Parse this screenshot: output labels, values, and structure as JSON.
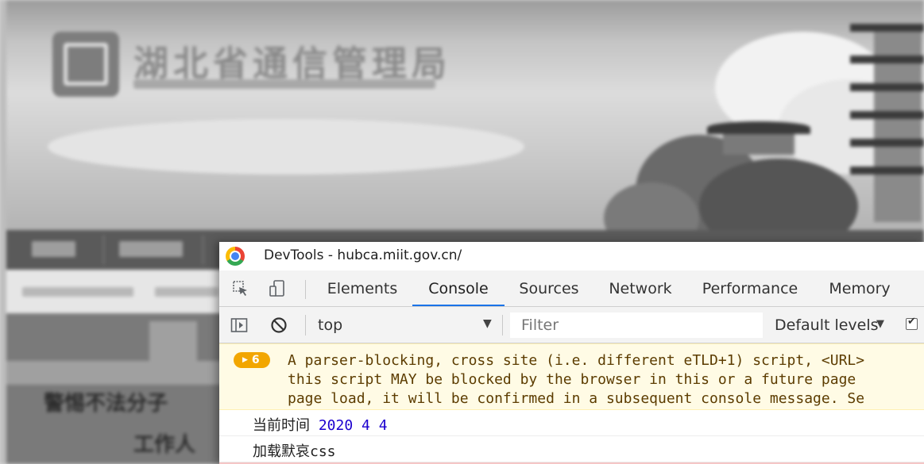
{
  "site": {
    "logo_title": "湖北省通信管理局",
    "headline_line1": "警惕不法分子",
    "headline_line2": "工作人"
  },
  "devtools": {
    "window_title": "DevTools - hubca.miit.gov.cn/",
    "tabs": [
      {
        "label": "Elements",
        "active": false
      },
      {
        "label": "Console",
        "active": true
      },
      {
        "label": "Sources",
        "active": false
      },
      {
        "label": "Network",
        "active": false
      },
      {
        "label": "Performance",
        "active": false
      },
      {
        "label": "Memory",
        "active": false
      }
    ],
    "toolbar": {
      "context": "top",
      "filter_placeholder": "Filter",
      "levels": "Default levels",
      "levels_checked": true
    },
    "console": {
      "warning": {
        "count": "6",
        "lines": [
          "A parser-blocking, cross site (i.e. different eTLD+1) script, <URL>",
          "this script MAY be blocked by the browser in this or a future page",
          "page load, it will be confirmed in a subsequent console message. Se"
        ]
      },
      "logs": [
        {
          "label": "当前时间",
          "values": "2020 4 4"
        },
        {
          "label": "加载默哀css",
          "values": ""
        }
      ]
    },
    "colors": {
      "accent": "#1a73e8",
      "warning_bg": "#fffbe5",
      "warning_badge": "#f2a600",
      "warning_text": "#5c3c00",
      "number": "#1c00cf"
    }
  }
}
